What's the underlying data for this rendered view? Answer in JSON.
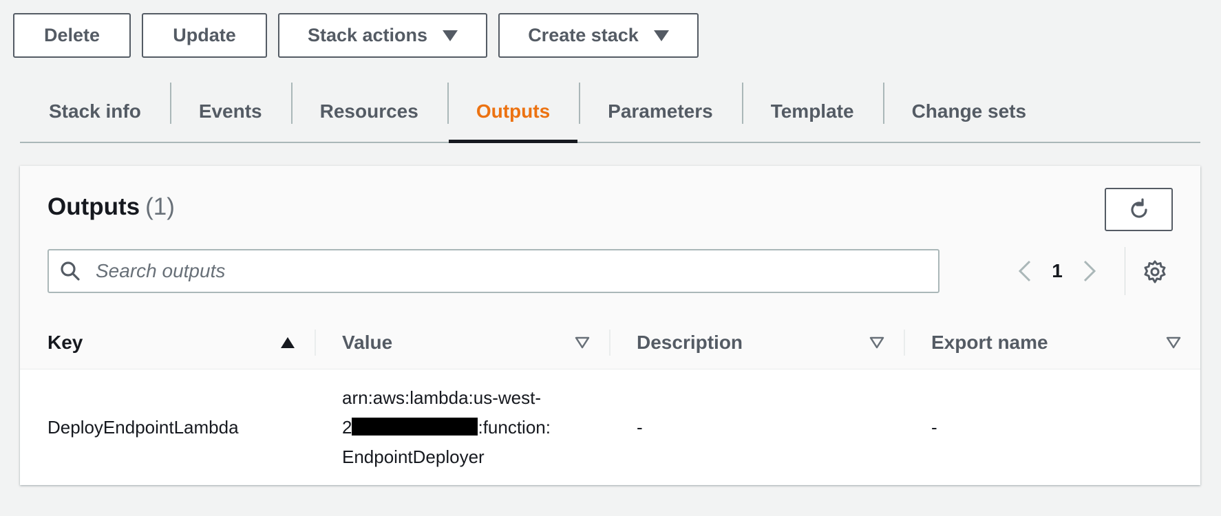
{
  "toolbar": {
    "delete_label": "Delete",
    "update_label": "Update",
    "stack_actions_label": "Stack actions",
    "create_stack_label": "Create stack"
  },
  "tabs": [
    {
      "label": "Stack info"
    },
    {
      "label": "Events"
    },
    {
      "label": "Resources"
    },
    {
      "label": "Outputs",
      "active": true
    },
    {
      "label": "Parameters"
    },
    {
      "label": "Template"
    },
    {
      "label": "Change sets"
    }
  ],
  "outputs": {
    "title": "Outputs",
    "count": "(1)",
    "search_placeholder": "Search outputs",
    "page": "1",
    "columns": {
      "key": "Key",
      "value": "Value",
      "description": "Description",
      "export_name": "Export name"
    },
    "rows": [
      {
        "key": "DeployEndpointLambda",
        "value_line1": "arn:aws:lambda:us-west-",
        "value_line2_prefix": "2",
        "value_line2_suffix": ":function:",
        "value_line3": "EndpointDeployer",
        "description": "-",
        "export_name": "-"
      }
    ]
  },
  "colors": {
    "accent": "#ec7211",
    "text": "#16191f",
    "secondary": "#545b64",
    "background": "#f2f3f3"
  },
  "icons": [
    "caret-down-icon",
    "refresh-icon",
    "search-icon",
    "chevron-left-icon",
    "chevron-right-icon",
    "gear-icon",
    "sort-ascending-icon",
    "sort-descending-icon"
  ]
}
